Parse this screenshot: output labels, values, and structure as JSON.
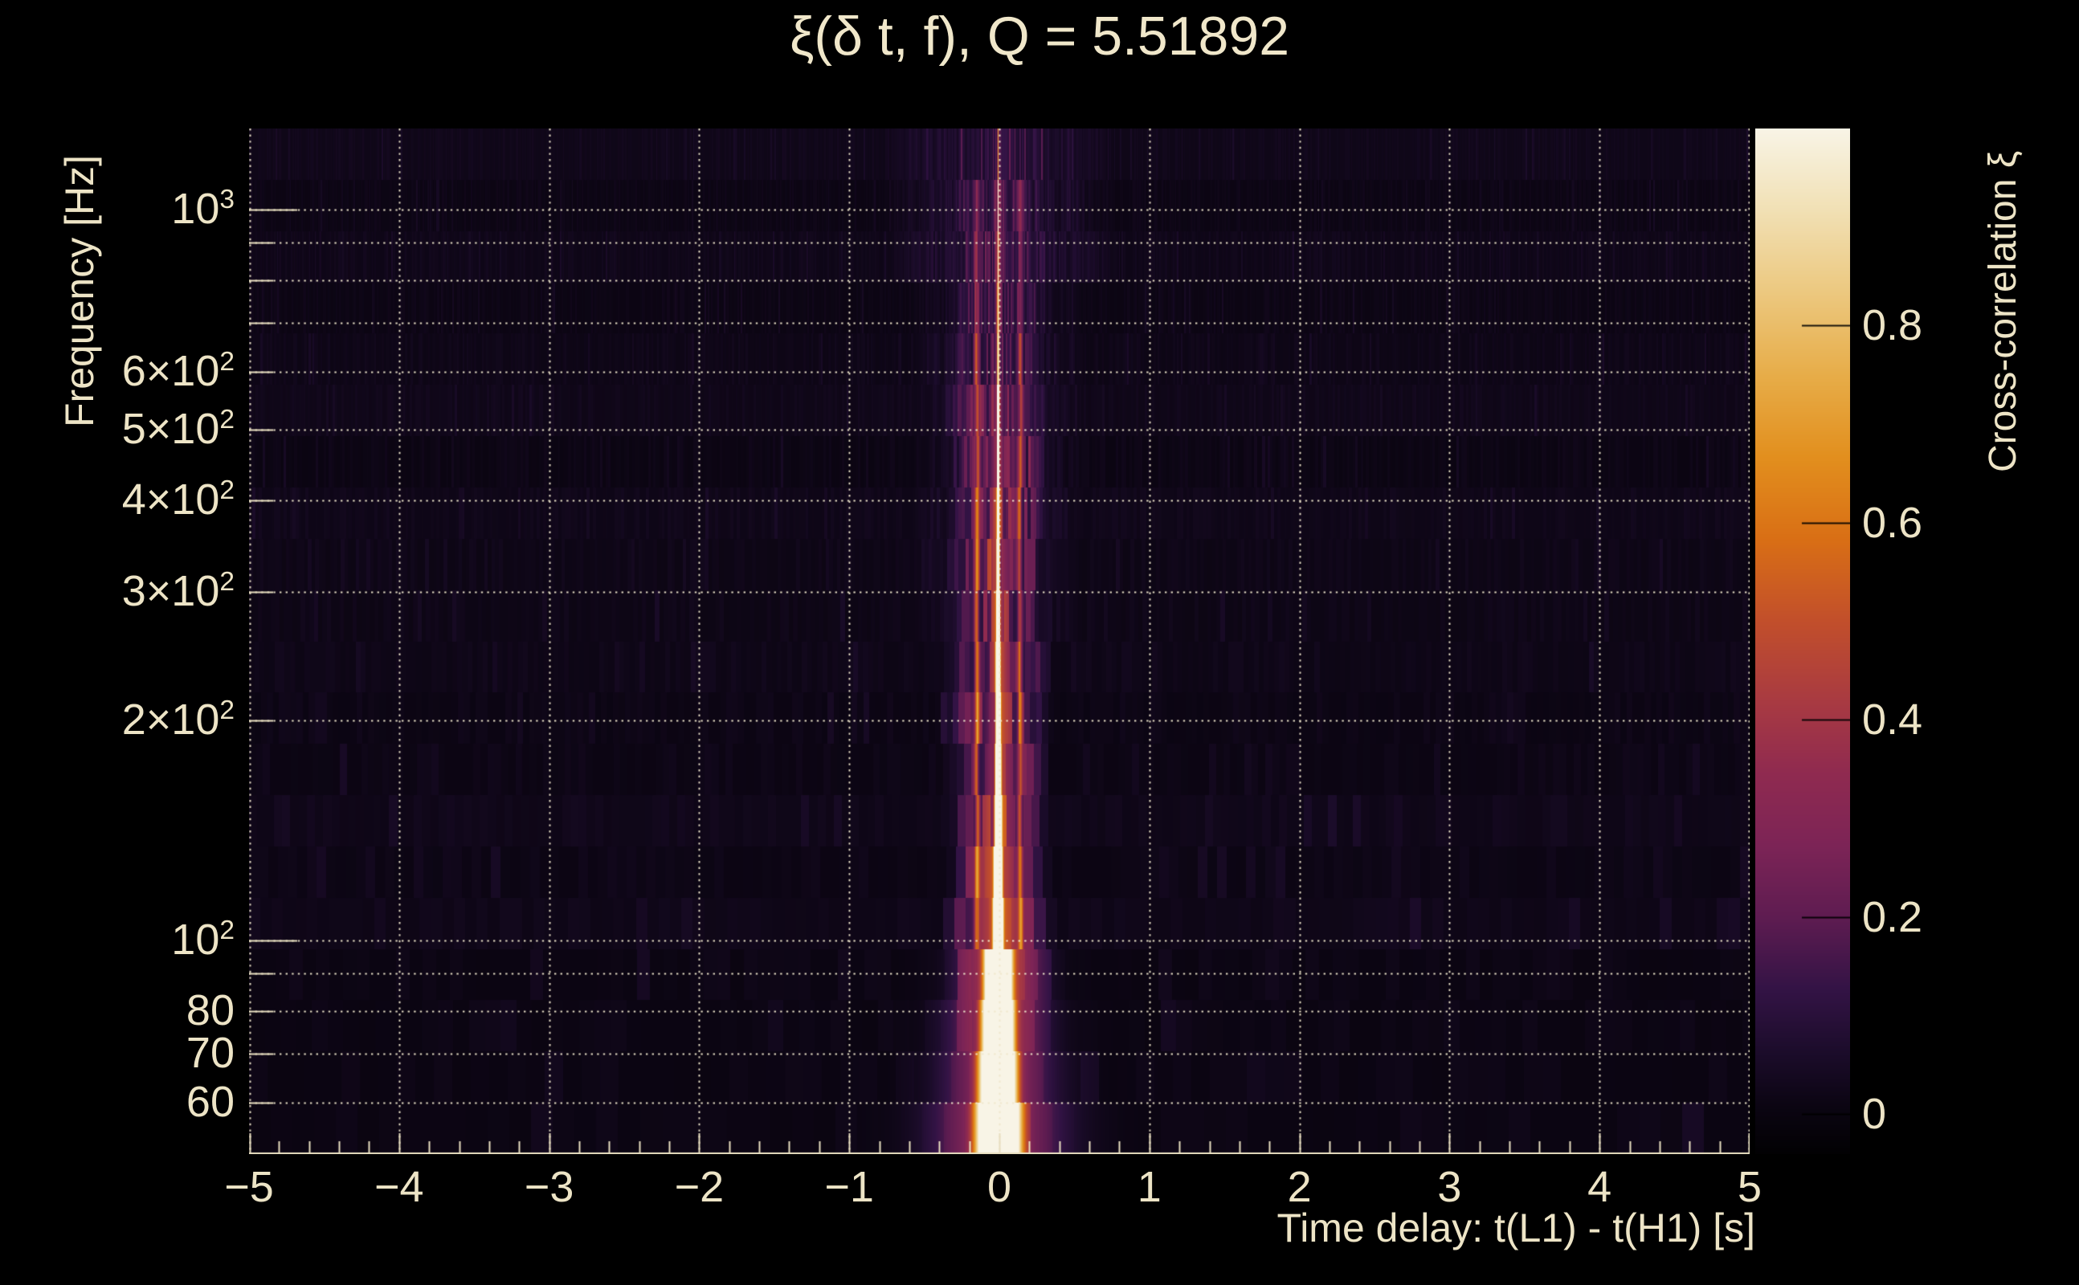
{
  "colors": {
    "background": "#000000",
    "text": "#ede4c6",
    "grid": "#f0e8cc",
    "axis": "#e8dfc0",
    "colorbar_tick": "#000000"
  },
  "chart_data": {
    "type": "heatmap",
    "title": "ξ(δ t, f), Q = 5.51892",
    "q_value": 5.51892,
    "xlabel": "Time delay: t(L1) - t(H1) [s]",
    "ylabel": "Frequency [Hz]",
    "colorbar_label": "Cross-correlation ξ",
    "x_range": [
      -5,
      5
    ],
    "x_ticks": [
      {
        "v": -5,
        "label": "−5"
      },
      {
        "v": -4,
        "label": "−4"
      },
      {
        "v": -3,
        "label": "−3"
      },
      {
        "v": -2,
        "label": "−2"
      },
      {
        "v": -1,
        "label": "−1"
      },
      {
        "v": 0,
        "label": "0"
      },
      {
        "v": 1,
        "label": "1"
      },
      {
        "v": 2,
        "label": "2"
      },
      {
        "v": 3,
        "label": "3"
      },
      {
        "v": 4,
        "label": "4"
      },
      {
        "v": 5,
        "label": "5"
      }
    ],
    "x_minor_tick_step": 0.2,
    "y_scale": "log",
    "y_range": [
      51,
      1290
    ],
    "y_ticks": [
      {
        "v": 1000,
        "base": "10",
        "exp": "3",
        "long": true
      },
      {
        "v": 600,
        "base": "6×10",
        "exp": "2"
      },
      {
        "v": 500,
        "base": "5×10",
        "exp": "2"
      },
      {
        "v": 400,
        "base": "4×10",
        "exp": "2"
      },
      {
        "v": 300,
        "base": "3×10",
        "exp": "2"
      },
      {
        "v": 200,
        "base": "2×10",
        "exp": "2"
      },
      {
        "v": 100,
        "base": "10",
        "exp": "2",
        "long": true
      },
      {
        "v": 80,
        "base": "80"
      },
      {
        "v": 70,
        "base": "70"
      },
      {
        "v": 60,
        "base": "60"
      }
    ],
    "grid_x_values": [
      -5,
      -4,
      -3,
      -2,
      -1,
      0,
      1,
      2,
      3,
      4,
      5
    ],
    "grid_y_values": [
      60,
      70,
      80,
      90,
      100,
      200,
      300,
      400,
      500,
      600,
      700,
      800,
      900,
      1000
    ],
    "grid_on": true,
    "legend_position": "right-colorbar",
    "colorbar": {
      "range": [
        -0.04,
        1.0
      ],
      "ticks": [
        {
          "v": 0,
          "label": "0"
        },
        {
          "v": 0.2,
          "label": "0.2"
        },
        {
          "v": 0.4,
          "label": "0.4"
        },
        {
          "v": 0.6,
          "label": "0.6"
        },
        {
          "v": 0.8,
          "label": "0.8"
        }
      ],
      "colormap_stops": [
        [
          0.0,
          "#020103"
        ],
        [
          0.045,
          "#0b0512"
        ],
        [
          0.1,
          "#1c0c2b"
        ],
        [
          0.16,
          "#331345"
        ],
        [
          0.23,
          "#5e1c51"
        ],
        [
          0.3,
          "#7c2456"
        ],
        [
          0.37,
          "#8f2a50"
        ],
        [
          0.44,
          "#a83a42"
        ],
        [
          0.52,
          "#c24f2b"
        ],
        [
          0.6,
          "#d96f15"
        ],
        [
          0.68,
          "#e28f1e"
        ],
        [
          0.76,
          "#e7ad49"
        ],
        [
          0.84,
          "#ecc87f"
        ],
        [
          0.92,
          "#f1e0b4"
        ],
        [
          1.0,
          "#f8f4e6"
        ]
      ]
    },
    "data_summary": {
      "main_peak": {
        "time_delay_s": -0.008,
        "xi_peak": 1.0,
        "brightest_below_hz": 100
      },
      "side_lobes_time_s": [
        -0.148,
        0.138
      ],
      "halo_halfwidth_s": 0.28,
      "wing_halfwidth_s": 0.6,
      "background_xi": 0.02
    },
    "render": {
      "seed": 987,
      "rows": 20,
      "f_min": 51,
      "f_max": 1290,
      "t_min": -5,
      "t_max": 5,
      "peak_center_s": -0.008,
      "peak_amp_low_f": 1.06,
      "peak_amp_mid_f": 0.94,
      "peak_amp_high_f": 0.52,
      "side_lobe_amp": 0.3,
      "tile_width_coeff_s_hz": 8
    }
  }
}
